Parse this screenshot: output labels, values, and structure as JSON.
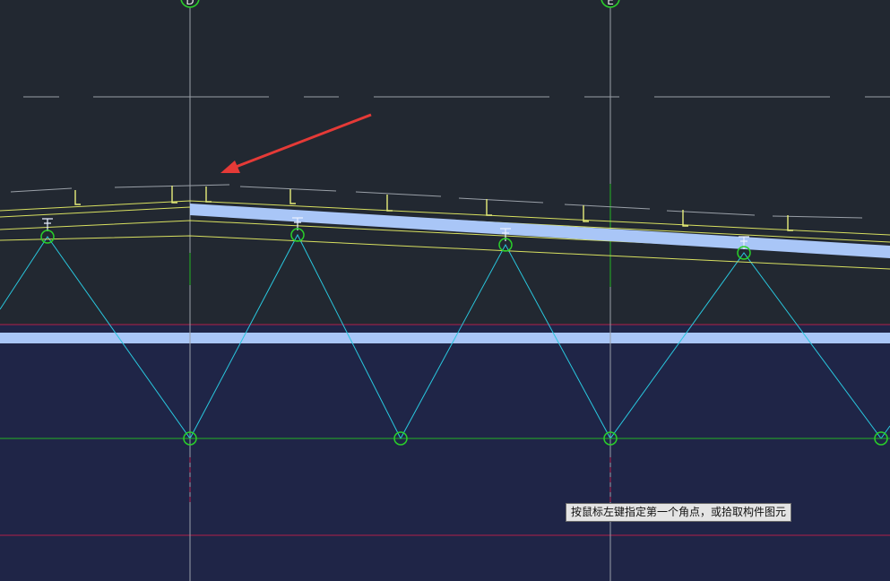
{
  "canvas": {
    "background": "#222831",
    "lower_region_fill": "#1f2547"
  },
  "axes": {
    "left_label": "D",
    "right_label": "E"
  },
  "colors": {
    "grid_axis": "#9aa0a8",
    "dash_line": "#9aa0a8",
    "purlin": "#e7ee7a",
    "chord": "#d8e060",
    "beam_fill": "#a9c6f7",
    "web_member": "#29c7de",
    "bottom_chord": "#24b324",
    "node": "#2ad12a",
    "arrow": "#e53a37",
    "hidden_line": "#b0204a"
  },
  "annotations": {
    "arrow_icon": "red-arrow-pointer"
  },
  "tooltip": {
    "text": "按鼠标左键指定第一个角点，或拾取构件图元"
  }
}
